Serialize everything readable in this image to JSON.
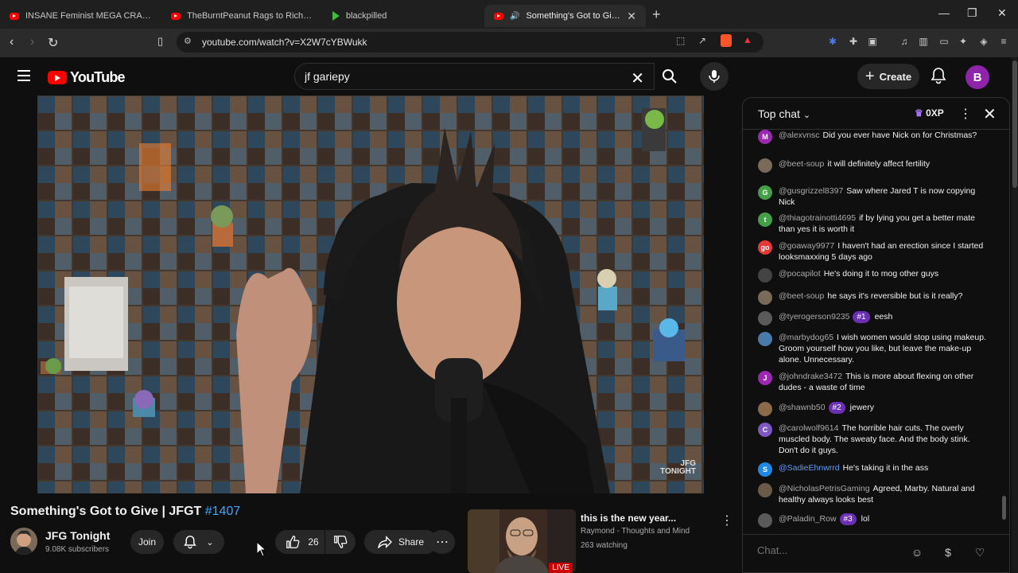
{
  "browser": {
    "tabs": [
      {
        "label": "INSANE Feminist MEGA CRASHOUT"
      },
      {
        "label": "TheBurntPeanut Rags to Riches | ARC"
      },
      {
        "label": "blackpilled"
      },
      {
        "label": "Something's Got to Give | JFGT"
      }
    ],
    "url": "youtube.com/watch?v=X2W7cYBWukk"
  },
  "header": {
    "logo_text": "YouTube",
    "search_value": "jf gariepy",
    "create_label": "Create",
    "avatar_letter": "B"
  },
  "video": {
    "watermark_line1": "JFG",
    "watermark_line2": "TONIGHT",
    "title": "Something's Got to Give | JFGT",
    "hashtag": "#1407",
    "channel_name": "JFG Tonight",
    "subscribers": "9.08K subscribers",
    "join_label": "Join",
    "likes": "26",
    "share_label": "Share"
  },
  "next_up": {
    "title": "this is the new year...",
    "channel": "Raymond - Thoughts and Mind",
    "watching": "263 watching",
    "live_label": "LIVE"
  },
  "chat": {
    "mode_label": "Top chat",
    "xp_label": "0XP",
    "input_placeholder": "Chat...",
    "messages": [
      {
        "author": "@alexvnsc",
        "text": "Did you ever have Nick on for Christmas?",
        "avatar": "M",
        "color": "#9c27b0"
      },
      {
        "author": "@beet-soup",
        "text": "it will definitely affect fertility",
        "avatar": "",
        "color": "#7a6a5a"
      },
      {
        "author": "@gusgrizzel8397",
        "text": "Saw where Jared T is now copying Nick",
        "avatar": "G",
        "color": "#43a047"
      },
      {
        "author": "@thiagotrainotti4695",
        "text": "if by lying you get a better mate than yes it is worth it",
        "avatar": "t",
        "color": "#43a047"
      },
      {
        "author": "@goaway9977",
        "text": "I haven't had an erection since I started looksmaxxing 5 days ago",
        "avatar": "go",
        "color": "#e53935"
      },
      {
        "author": "@pocapilot",
        "text": "He's doing it to mog other guys",
        "avatar": "",
        "color": "#444"
      },
      {
        "author": "@beet-soup",
        "text": "he says it's reversible but is it really?",
        "avatar": "",
        "color": "#7a6a5a"
      },
      {
        "author": "@tyerogerson9235",
        "rank": "#1",
        "text": "eesh",
        "avatar": "",
        "color": "#5a5a5a"
      },
      {
        "author": "@marbydog65",
        "text": "I wish women would stop using makeup. Groom yourself how you like, but leave the make-up alone. Unnecessary.",
        "avatar": "",
        "color": "#4a7aa8"
      },
      {
        "author": "@johndrake3472",
        "text": "This is more about flexing on other dudes - a waste of time",
        "avatar": "J",
        "color": "#9c27b0"
      },
      {
        "author": "@shawnb50",
        "rank": "#2",
        "text": "jewery",
        "avatar": "",
        "color": "#8a6a4a"
      },
      {
        "author": "@carolwolf9614",
        "text": "The horrible hair cuts. The overly muscled body. The sweaty face. And the body stink. Don't do it guys.",
        "avatar": "C",
        "color": "#7e57c2"
      },
      {
        "author": "@SadieEhnwrrd",
        "text": "He's taking it in the ass",
        "avatar": "S",
        "color": "#1e88e5",
        "blue": true
      },
      {
        "author": "@NicholasPetrisGaming",
        "text": "Agreed, Marby. Natural and healthy always looks best",
        "avatar": "",
        "color": "#6a5a4a"
      },
      {
        "author": "@Paladin_Row",
        "rank": "#3",
        "text": "lol",
        "avatar": "",
        "color": "#5a5a5a"
      }
    ]
  }
}
